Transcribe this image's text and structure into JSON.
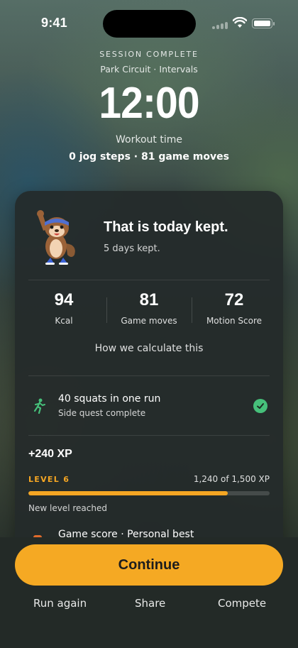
{
  "status": {
    "time": "9:41"
  },
  "header": {
    "eyebrow": "SESSION COMPLETE",
    "subtitle": "Park Circuit · Intervals",
    "duration": "12:00",
    "duration_label": "Workout time",
    "summary": "0 jog steps · 81 game moves"
  },
  "card": {
    "mascot_icon": "otter-mascot-icon",
    "title": "That is today kept.",
    "subtitle": "5 days kept.",
    "stats": [
      {
        "value": "94",
        "label": "Kcal"
      },
      {
        "value": "81",
        "label": "Game moves"
      },
      {
        "value": "72",
        "label": "Motion Score"
      }
    ],
    "calc_link": "How we calculate this",
    "quest": {
      "icon": "running-figure-icon",
      "title": "40 squats in one run",
      "subtitle": "Side quest complete",
      "status_icon": "check-circle-icon",
      "status_color": "#46c07a"
    },
    "xp": {
      "gain": "+240 XP",
      "level": "LEVEL 6",
      "progress_text": "1,240 of 1,500 XP",
      "progress_fraction": 0.827,
      "note": "New level reached",
      "accent": "#f5a623"
    },
    "peek_item": "Game score · Personal best"
  },
  "footer": {
    "primary": "Continue",
    "actions": [
      "Run again",
      "Share",
      "Compete"
    ]
  }
}
